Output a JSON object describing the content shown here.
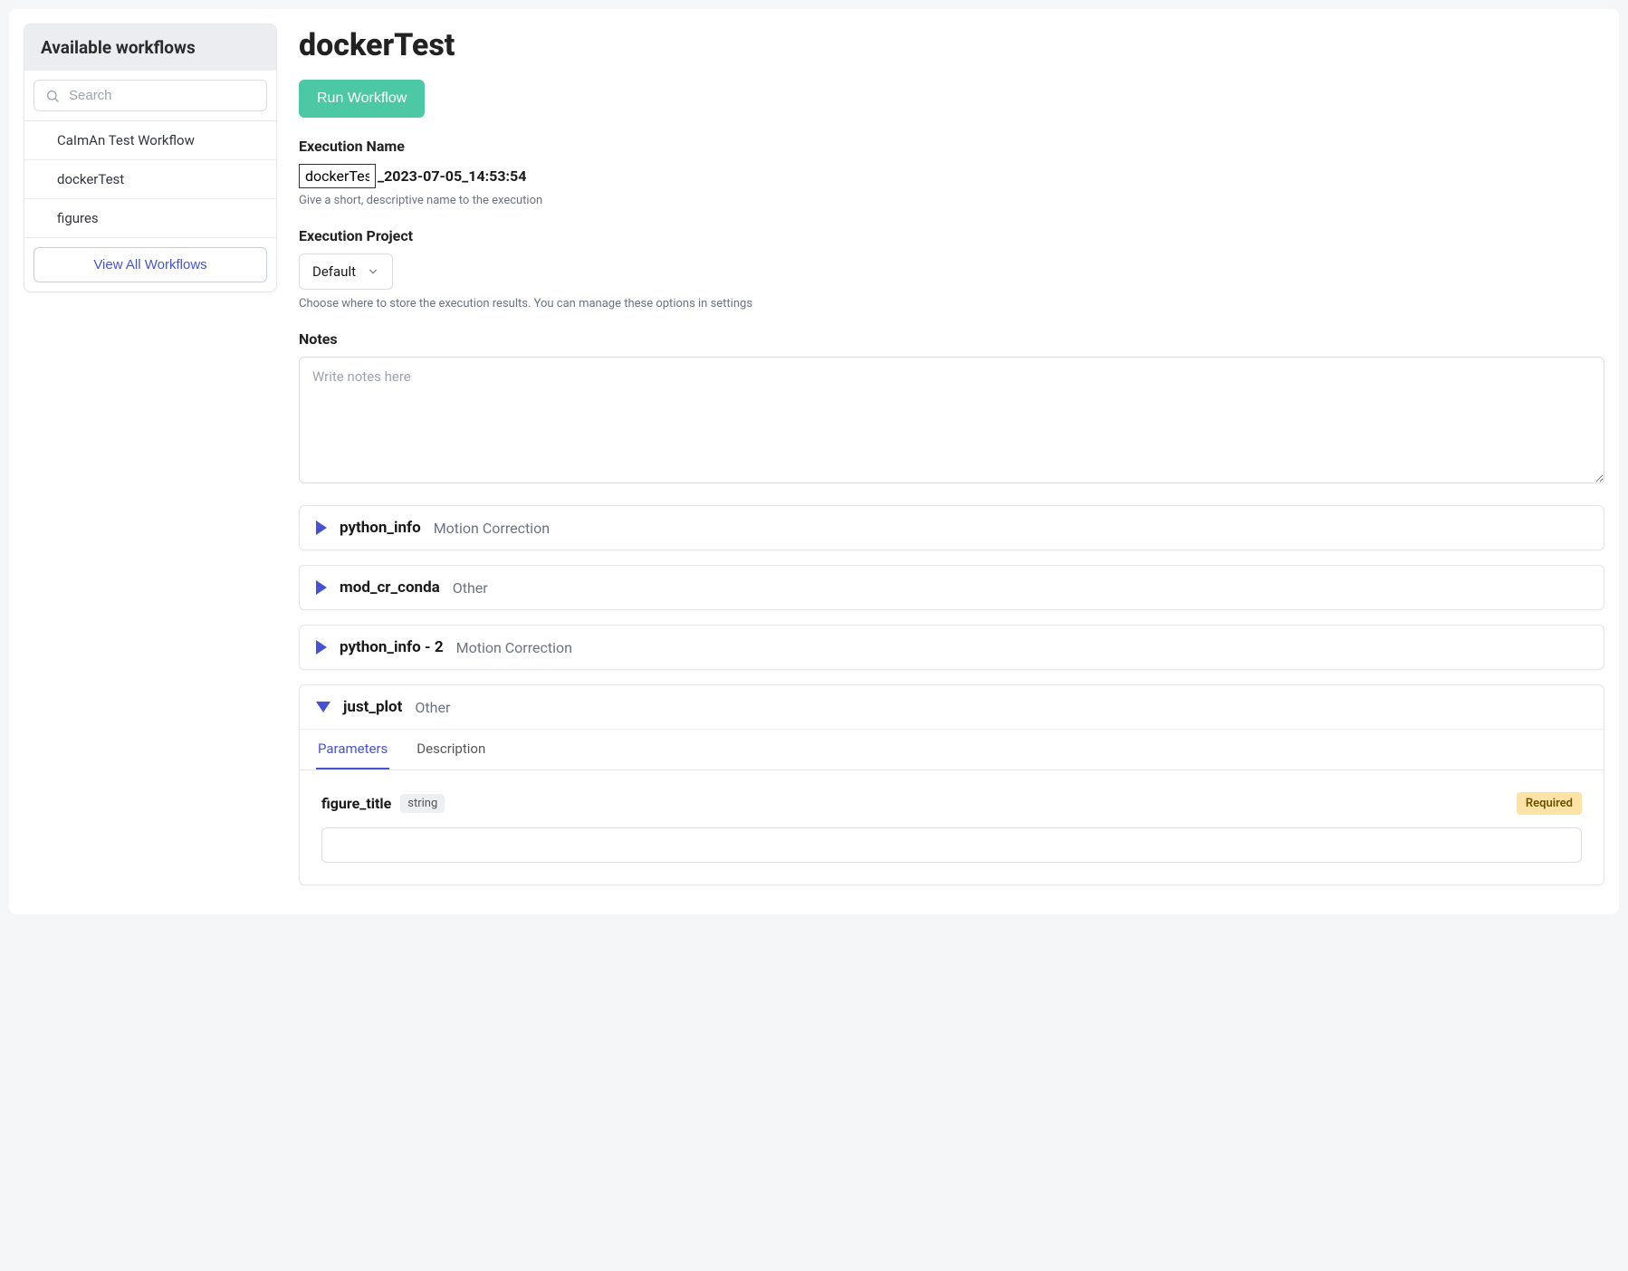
{
  "sidebar": {
    "title": "Available workflows",
    "search_placeholder": "Search",
    "items": [
      {
        "label": "CaImAn Test Workflow"
      },
      {
        "label": "dockerTest"
      },
      {
        "label": "figures"
      }
    ],
    "view_all_label": "View All Workflows"
  },
  "main": {
    "title": "dockerTest",
    "run_label": "Run Workflow",
    "exec_name": {
      "label": "Execution Name",
      "prefix_value": "dockerTest",
      "suffix": "_2023-07-05_14:53:54",
      "helper": "Give a short, descriptive name to the execution"
    },
    "exec_project": {
      "label": "Execution Project",
      "selected": "Default",
      "helper": "Choose where to store the execution results. You can manage these options in settings"
    },
    "notes": {
      "label": "Notes",
      "placeholder": "Write notes here"
    },
    "steps": [
      {
        "name": "python_info",
        "tag": "Motion Correction",
        "expanded": false
      },
      {
        "name": "mod_cr_conda",
        "tag": "Other",
        "expanded": false
      },
      {
        "name": "python_info - 2",
        "tag": "Motion Correction",
        "expanded": false
      },
      {
        "name": "just_plot",
        "tag": "Other",
        "expanded": true
      }
    ],
    "tabs": {
      "parameters": "Parameters",
      "description": "Description"
    },
    "param": {
      "name": "figure_title",
      "type": "string",
      "required_label": "Required"
    }
  }
}
